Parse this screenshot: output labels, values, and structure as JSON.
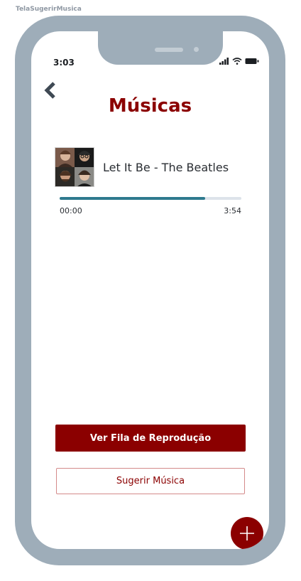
{
  "frame_label": "TelaSugerirMusica",
  "status_bar": {
    "time": "3:03"
  },
  "header": {
    "title": "Músicas"
  },
  "now_playing": {
    "song_label": "Let It Be - The Beatles",
    "elapsed": "00:00",
    "duration": "3:54",
    "progress_fraction": 0.8
  },
  "actions": {
    "queue_button": "Ver Fila de Reprodução",
    "suggest_button": "Sugerir Música"
  },
  "colors": {
    "primary": "#8b0000",
    "progress": "#2e7a8e",
    "device_frame": "#9eadb9"
  },
  "icons": {
    "back": "chevron-left-icon",
    "add": "plus-icon"
  }
}
